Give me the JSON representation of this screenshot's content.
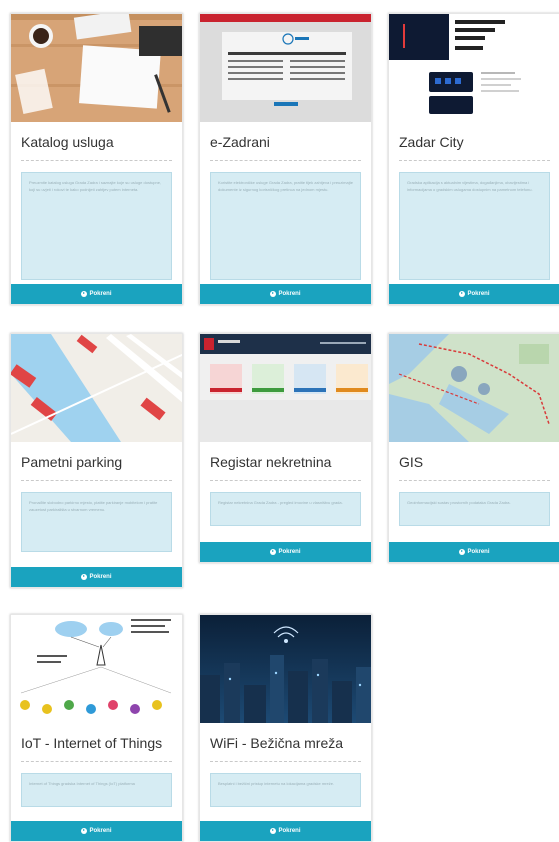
{
  "cards": [
    {
      "title": "Katalog usluga",
      "description": "Preuzmite katalog usluga Grada Zadra i saznajte koje su usluge dostupne, koji su uvjeti i rokovi te kako podnijeti zahtjev putem interneta.",
      "button": "Pokreni"
    },
    {
      "title": "e-Zadrani",
      "description": "Koristite elektroničke usluge Grada Zadra, pratite tijek zahtjeva i preuzimajte dokumente iz sigurnog korisničkog pretinca na jednom mjestu.",
      "button": "Pokreni"
    },
    {
      "title": "Zadar City",
      "description": "Gradska aplikacija s aktualnim vijestima, događanjima, obavijestima i informacijama o gradskim uslugama dostupnim na pametnom telefonu.",
      "button": "Pokreni"
    },
    {
      "title": "Pametni parking",
      "description": "Pronađite slobodno parkirno mjesto, platite parkiranje mobitelom i pratite zauzetost parkirališta u stvarnom vremenu.",
      "button": "Pokreni"
    },
    {
      "title": "Registar nekretnina",
      "description": "Registar nekretnina Grada Zadra - pregled imovine u vlasništvu grada.",
      "button": "Pokreni"
    },
    {
      "title": "GIS",
      "description": "Geoinformacijski sustav prostornih podataka Grada Zadra.",
      "button": "Pokreni"
    },
    {
      "title": "IoT - Internet of Things",
      "description": "Internet of Things gradska Internet of Things (IoT) platforma",
      "button": "Pokreni"
    },
    {
      "title": "WiFi - Bežična mreža",
      "description": "Besplatni i bežični pristup internetu na lokacijama gradske mreže.",
      "button": "Pokreni"
    }
  ],
  "thumbs": {
    "ezadrani_heading": "e-Zadrani",
    "zadarcity_heading": "Zadar City"
  }
}
